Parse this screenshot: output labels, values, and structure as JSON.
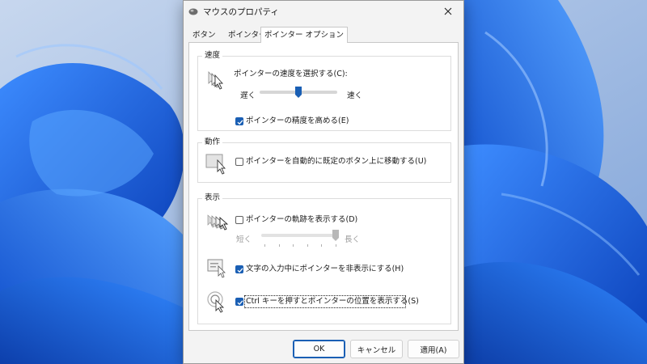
{
  "window": {
    "title": "マウスのプロパティ"
  },
  "tabs": [
    {
      "label": "ボタン",
      "active": false
    },
    {
      "label": "ポインター",
      "active": false
    },
    {
      "label": "ポインター オプション",
      "active": true
    }
  ],
  "motion": {
    "group_title": "速度",
    "speed_label": "ポインターの速度を選択する(C):",
    "slow_label": "遅く",
    "fast_label": "速く",
    "speed_value": 0.5,
    "precision_label": "ポインターの精度を高める(E)",
    "precision_checked": true
  },
  "snap": {
    "group_title": "動作",
    "snap_label": "ポインターを自動的に既定のボタン上に移動する(U)",
    "snap_checked": false
  },
  "visibility": {
    "group_title": "表示",
    "trails_label": "ポインターの軌跡を表示する(D)",
    "trails_checked": false,
    "short_label": "短く",
    "long_label": "長く",
    "trails_value": 1.0,
    "hide_label": "文字の入力中にポインターを非表示にする(H)",
    "hide_checked": true,
    "ctrl_label": "Ctrl キーを押すとポインターの位置を表示する(S)",
    "ctrl_checked": true
  },
  "buttons": {
    "ok": "OK",
    "cancel": "キャンセル",
    "apply": "適用(A)"
  },
  "colors": {
    "accent": "#1a5fb4",
    "wallpaper_bloom": "#1e6ff0",
    "dialog_bg": "#f3f3f3"
  },
  "icons": {
    "title": "mouse-icon",
    "close": "close-icon",
    "speed": "pointer-speed-icon",
    "snap": "snap-to-button-icon",
    "trails": "pointer-trails-icon",
    "hide": "hide-pointer-icon",
    "ctrl": "pointer-location-icon"
  }
}
